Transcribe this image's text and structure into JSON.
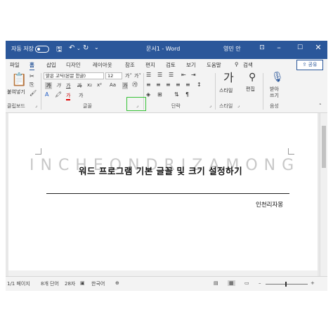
{
  "titlebar": {
    "autosave_label": "자동 저장",
    "doc_title": "문서1 - Word",
    "user_name": "영민 안",
    "icons": [
      "save-icon",
      "undo-icon",
      "redo-icon",
      "customize-icon",
      "ribbon-display-icon",
      "minimize-icon",
      "maximize-icon",
      "close-icon"
    ],
    "bg_color": "#2b579a"
  },
  "tabs": [
    "파일",
    "홈",
    "삽입",
    "디자인",
    "레이아웃",
    "참조",
    "편지",
    "검토",
    "보기",
    "도움말"
  ],
  "active_tab": "홈",
  "search_label": "검색",
  "share_label": "공유",
  "ribbon": {
    "clipboard": {
      "paste_label": "붙여넣기",
      "group_label": "클립보드"
    },
    "font": {
      "font_name": "맑은 고딕(본문 한글)",
      "font_size": "12",
      "bold": "가",
      "italic": "가",
      "underline": "가",
      "strike": "가",
      "subscript": "x₂",
      "superscript": "x²",
      "grow": "가˄",
      "shrink": "가˅",
      "case": "Aa",
      "clear": "가",
      "color_a": "가",
      "phonetic": "가",
      "group_label": "글꼴"
    },
    "paragraph": {
      "group_label": "단락"
    },
    "styles": {
      "label": "스타일",
      "group_label": "스타일"
    },
    "editing": {
      "label": "편집"
    },
    "voice": {
      "label_line1": "받아",
      "label_line2": "쓰기",
      "group_label": "음성"
    }
  },
  "document": {
    "watermark": "INCHEONDRIZAMONG",
    "title": "워드 프로그램 기본 글꼴 및 크기 설정하기",
    "author": "인천리자몽"
  },
  "status": {
    "page": "1/1 페이지",
    "words": "8개 단어",
    "chars": "28자",
    "language": "한국어"
  }
}
